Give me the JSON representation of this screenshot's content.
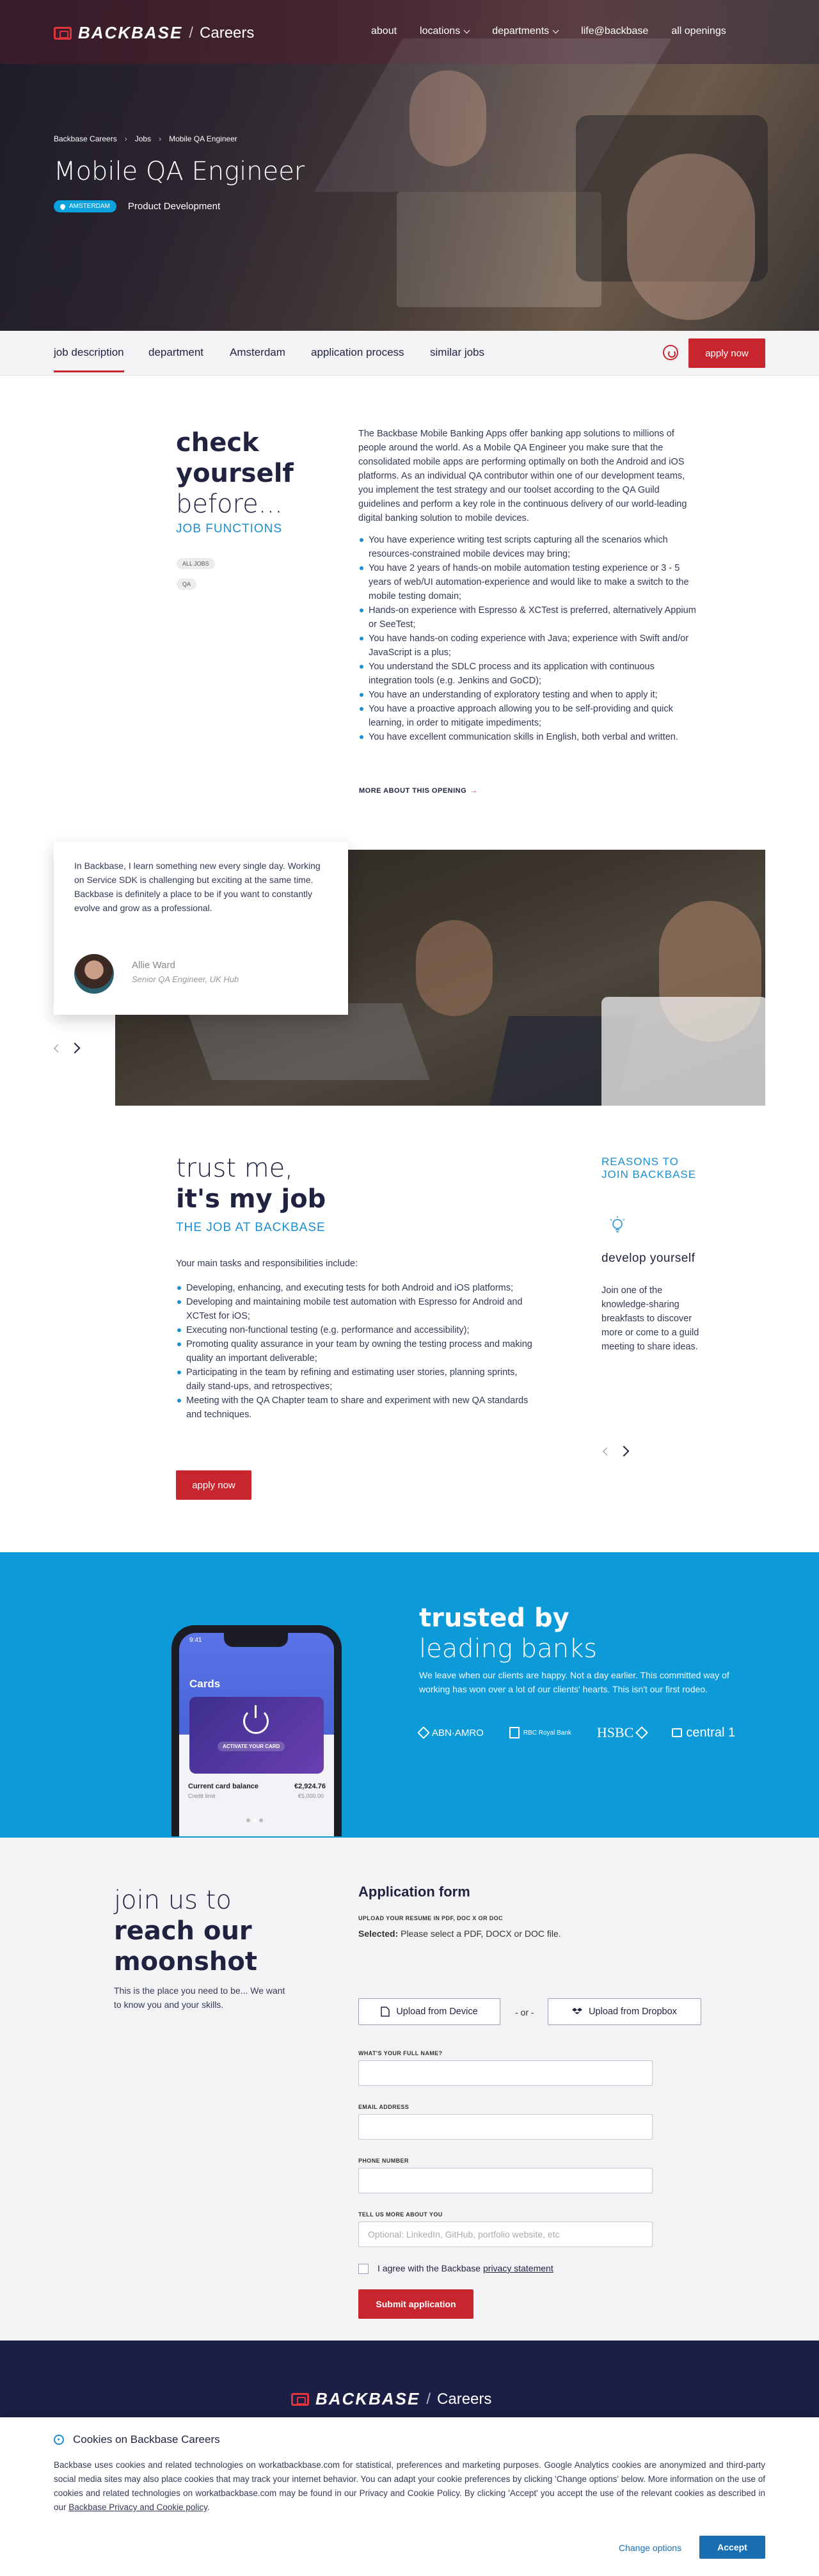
{
  "header": {
    "logo": "BACKBASE",
    "separator": "/",
    "careers": "Careers",
    "nav": [
      "about",
      "locations",
      "departments",
      "life@backbase",
      "all openings"
    ]
  },
  "hero": {
    "breadcrumbs": [
      "Backbase Careers",
      "Jobs",
      "Mobile QA Engineer"
    ],
    "breadcrumb_sep": "›",
    "title": "Mobile QA Engineer",
    "location_pill": "AMSTERDAM",
    "department": "Product Development"
  },
  "tabs": {
    "items": [
      "job description",
      "department",
      "Amsterdam",
      "application process",
      "similar jobs"
    ],
    "apply": "apply now"
  },
  "intro": {
    "heading_1": "check",
    "heading_2": "yourself",
    "heading_3": "before...",
    "subheading": "JOB FUNCTIONS",
    "tags": [
      "ALL JOBS",
      "QA"
    ],
    "paragraph": "The Backbase Mobile Banking Apps offer banking app solutions to millions of people around the world. As a Mobile QA Engineer you make sure that the consolidated mobile apps are performing optimally on both the Android and iOS platforms.  As an individual QA contributor within one of our development teams, you implement the test strategy and our toolset according to the QA Guild guidelines and perform a key role in the continuous delivery of our world-leading digital banking solution to mobile devices.",
    "requirements": [
      "You have experience writing test scripts capturing all the scenarios which resources-constrained mobile devices may bring;",
      "You have 2 years of hands-on mobile automation testing experience or 3 - 5 years of web/UI automation-experience and would like to make a switch to the mobile testing domain;",
      "Hands-on experience with Espresso & XCTest is preferred, alternatively Appium or SeeTest;",
      "You have hands-on coding experience with Java; experience with Swift and/or JavaScript is a plus;",
      "You understand the SDLC process and its application with continuous integration tools (e.g. Jenkins and GoCD);",
      "You have an understanding of exploratory testing and when to apply it;",
      "You have a proactive approach allowing you to be self-providing and quick learning, in order to mitigate impediments;",
      "You have excellent communication skills in English, both verbal and written."
    ],
    "more_link": "MORE ABOUT THIS OPENING",
    "more_arrow": "→"
  },
  "testimonial": {
    "quote": "In Backbase, I learn something new every single day. Working on Service SDK is challenging but exciting at the same time. Backbase is definitely a place to be if you want to constantly evolve and grow as a professional.",
    "name": "Allie Ward",
    "role": "Senior QA Engineer, UK Hub"
  },
  "job": {
    "heading_1": "trust me,",
    "heading_2": "it's my job",
    "subheading": "THE JOB AT BACKBASE",
    "intro": "Your main tasks and responsibilities include:",
    "tasks": [
      "Developing, enhancing, and executing tests for both Android and iOS platforms;",
      "Developing and maintaining mobile test automation with Espresso for Android and XCTest for iOS;",
      "Executing non-functional testing (e.g. performance and accessibility);",
      "Promoting quality assurance in your team by owning the testing process and making quality an important deliverable;",
      "Participating in the team by refining and estimating user stories, planning sprints, daily stand-ups, and retrospectives;",
      "Meeting with the QA Chapter team to share and experiment with new QA standards and techniques."
    ],
    "apply": "apply now",
    "reasons_1": "REASONS TO",
    "reasons_2": "JOIN BACKBASE",
    "reason_title": "develop yourself",
    "reason_text": "Join one of the knowledge-sharing breakfasts to discover more or come to a guild meeting to share ideas."
  },
  "trusted": {
    "heading_1": "trusted by",
    "heading_2": "leading banks",
    "text": "We leave when our clients are happy. Not a day earlier. This committed way of working has won over a lot of our clients' hearts. This isn't our first rodeo.",
    "banks": [
      "ABN·AMRO",
      "RBC Royal Bank",
      "HSBC",
      "central 1"
    ],
    "phone": {
      "time": "9:41",
      "cards": "Cards",
      "activate": "ACTIVATE YOUR CARD",
      "balance_label": "Current card balance",
      "balance": "€2,924.76",
      "credit_label": "Credit limit",
      "credit": "€5,000.00"
    }
  },
  "form": {
    "heading_1": "join us to",
    "heading_2": "reach our",
    "heading_3": "moonshot",
    "text": "This is the place you need to be... We want to know you and your skills.",
    "title": "Application form",
    "upload_label": "UPLOAD YOUR RESUME IN PDF, DOC X OR DOC",
    "selected_label": "Selected:",
    "selected_value": "Please select a PDF, DOCX or DOC file.",
    "upload_device": "Upload from Device",
    "or": "- or -",
    "upload_dropbox": "Upload from Dropbox",
    "name_label": "WHAT'S YOUR FULL NAME?",
    "email_label": "EMAIL ADDRESS",
    "phone_label": "PHONE NUMBER",
    "about_label": "TELL US MORE ABOUT YOU",
    "about_placeholder": "Optional: LinkedIn, GitHub, portfolio website, etc",
    "agree_text": "I agree with the Backbase ",
    "agree_link": "privacy statement",
    "submit": "Submit application"
  },
  "footer": {
    "logo": "BACKBASE",
    "separator": "/",
    "careers": "Careers"
  },
  "cookie": {
    "title": "Cookies on Backbase Careers",
    "text": "Backbase uses cookies and related technologies on workatbackbase.com for statistical, preferences and marketing purposes. Google Analytics cookies are anonymized and third-party social media sites may also place cookies that may track your internet behavior. You can adapt your cookie preferences by clicking 'Change options' below. More information on the use of cookies and related technologies on workatbackbase.com may be found in our Privacy and Cookie Policy. By clicking 'Accept' you accept the use of the relevant cookies as described in our ",
    "link": "Backbase Privacy and Cookie policy",
    "period": ".",
    "change_options": "Change options",
    "accept": "Accept"
  },
  "colors": {
    "brand_red": "#c8252f",
    "brand_blue": "#0d9ad9",
    "navy": "#1b1f45"
  }
}
